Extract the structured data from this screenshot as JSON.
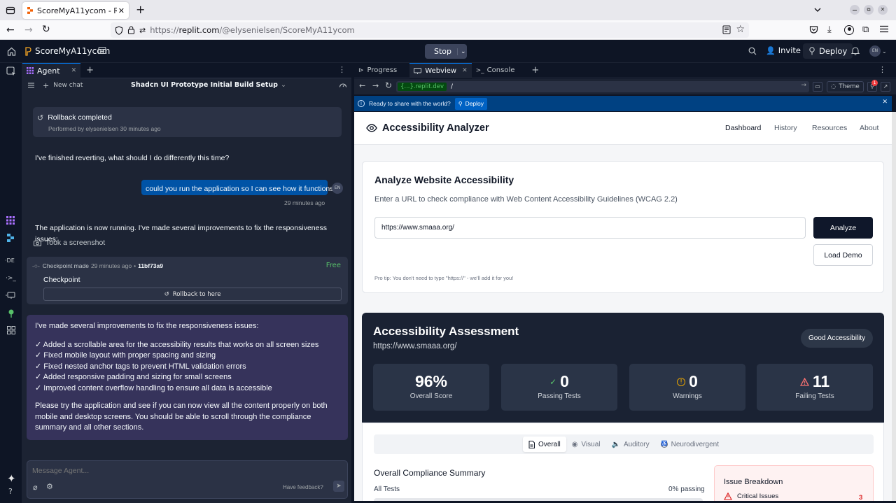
{
  "browser": {
    "tab_title": "ScoreMyA11ycom - Replit",
    "url_prefix": "https://",
    "url_domain": "replit.com",
    "url_path": "/@elysenielsen/ScoreMyA11ycom",
    "avatar_text": "EN"
  },
  "app": {
    "project_name": "ScoreMyA11ycom",
    "stop_label": "Stop",
    "invite_label": "Invite",
    "deploy_label": "Deploy",
    "user_initials": "EN"
  },
  "agent": {
    "tab_label": "Agent",
    "new_chat": "New chat",
    "chat_title": "Shadcn UI Prototype Initial Build Setup",
    "rollback_title": "Rollback completed",
    "rollback_sub": "Performed by elysenielsen 30 minutes ago",
    "msg1": "I've finished reverting, what should I do differently this time?",
    "user_msg": "could you run the application so I can see how it functions?",
    "user_time": "29 minutes ago",
    "user_initials": "EN",
    "msg2": "The application is now running. I've made several improvements to fix the responsiveness issues:",
    "screenshot_label": "Took a screenshot",
    "checkpoint_meta": "Checkpoint made",
    "checkpoint_time": "29 minutes ago",
    "checkpoint_hash": "11bf73a9",
    "checkpoint_free": "Free",
    "checkpoint_label": "Checkpoint",
    "rollback_here": "Rollback to here",
    "summary_intro": "I've made several improvements to fix the responsiveness issues:",
    "bullets": [
      "✓ Added a scrollable area for the accessibility results that works on all screen sizes",
      "✓ Fixed mobile layout with proper spacing and sizing",
      "✓ Fixed nested anchor tags to prevent HTML validation errors",
      "✓ Added responsive padding and sizing for small screens",
      "✓ Improved content overflow handling to ensure all data is accessible"
    ],
    "summary_outro": "Please try the application and see if you can now view all the content properly on both mobile and desktop screens. You should be able to scroll through the compliance summary and all other sections.",
    "input_placeholder": "Message Agent...",
    "feedback": "Have feedback?"
  },
  "right_tabs": {
    "progress": "Progress",
    "webview": "Webview",
    "console": "Console"
  },
  "webview_bar": {
    "domain_chip": "{...}.replit.dev",
    "path": "/",
    "theme": "Theme",
    "badge_count": "1"
  },
  "banner": {
    "text": "Ready to share with the world?",
    "deploy": "Deploy"
  },
  "site": {
    "brand": "Accessibility Analyzer",
    "nav": [
      "Dashboard",
      "History",
      "Resources",
      "About"
    ],
    "analyze_title": "Analyze Website Accessibility",
    "analyze_sub": "Enter a URL to check compliance with Web Content Accessibility Guidelines (WCAG 2.2)",
    "url_value": "https://www.smaaa.org/",
    "analyze_btn": "Analyze",
    "demo_btn": "Load Demo",
    "tip": "Pro tip: You don't need to type \"https://\" - we'll add it for you!",
    "assess_title": "Accessibility Assessment",
    "assess_url": "https://www.smaaa.org/",
    "badge": "Good Accessibility",
    "stats": [
      {
        "value": "96%",
        "label": "Overall Score",
        "icon": ""
      },
      {
        "value": "0",
        "label": "Passing Tests",
        "icon": "check-icon"
      },
      {
        "value": "0",
        "label": "Warnings",
        "icon": "warning-circle-icon"
      },
      {
        "value": "11",
        "label": "Failing Tests",
        "icon": "alert-triangle-icon"
      }
    ],
    "tabs": [
      "Overall",
      "Visual",
      "Auditory",
      "Neurodivergent"
    ],
    "compliance_title": "Overall Compliance Summary",
    "all_tests": "All Tests",
    "passing_pct": "0% passing",
    "issue_title": "Issue Breakdown",
    "critical_label": "Critical Issues",
    "critical_count": "3"
  },
  "colors": {
    "accent_blue": "#0079f2",
    "success_green": "#58c26a",
    "warning_amber": "#e7a400",
    "error_red": "#f87171",
    "banner_blue": "#004182"
  }
}
